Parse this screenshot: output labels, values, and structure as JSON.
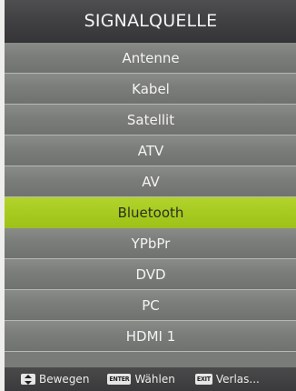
{
  "menu": {
    "title": "SIGNALQUELLE",
    "items": [
      {
        "label": "Antenne"
      },
      {
        "label": "Kabel"
      },
      {
        "label": "Satellit"
      },
      {
        "label": "ATV"
      },
      {
        "label": "AV"
      },
      {
        "label": "Bluetooth"
      },
      {
        "label": "YPbPr"
      },
      {
        "label": "DVD"
      },
      {
        "label": "PC"
      },
      {
        "label": "HDMI 1"
      }
    ],
    "selected_index": 5
  },
  "footer": {
    "move": {
      "icon": "up-down-arrows-icon",
      "label": "Bewegen"
    },
    "select": {
      "key": "ENTER",
      "label": "Wählen"
    },
    "exit": {
      "key": "EXIT",
      "label": "Verlas..."
    }
  },
  "colors": {
    "selected_bg": "#a8cb20",
    "item_bg": "#7b7d7a",
    "title_bg": "#3f3f41"
  }
}
